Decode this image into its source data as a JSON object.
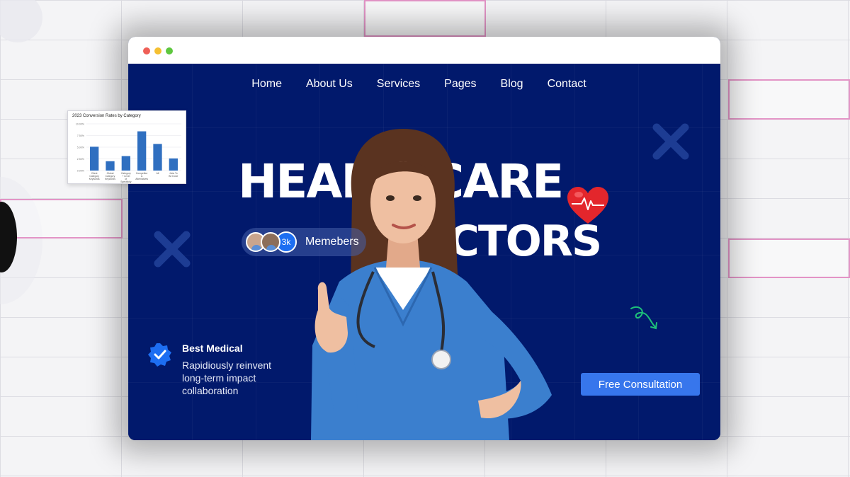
{
  "window": {
    "controls": [
      "close",
      "minimize",
      "maximize"
    ]
  },
  "nav": {
    "items": [
      {
        "label": "Home"
      },
      {
        "label": "About Us"
      },
      {
        "label": "Services"
      },
      {
        "label": "Pages"
      },
      {
        "label": "Blog"
      },
      {
        "label": "Contact"
      }
    ]
  },
  "hero": {
    "headline_line1": "HEALTHCARE",
    "headline_line2": "DOCTORS",
    "members": {
      "count": "3k",
      "label": "Memebers"
    },
    "feature": {
      "title": "Best Medical",
      "description": "Rapidiously reinvent long-term impact collaboration",
      "icon": "verified-badge-icon"
    },
    "cta_label": "Free Consultation"
  },
  "colors": {
    "hero_background": "#01196c",
    "cta": "#3776ec",
    "badge": "#1d6ef2",
    "heart": "#e3262c",
    "squiggle": "#1ec27a"
  },
  "chart_data": {
    "type": "bar",
    "title": "2023 Conversion Rates by Category",
    "categories": [
      "Client Category Keywords",
      "Global Category Keywords",
      "Category + Level of Specificity",
      "Competitor & Alternatives",
      "All",
      "Jobs To Be Done"
    ],
    "values": [
      5.1,
      2.0,
      3.1,
      8.4,
      5.7,
      2.6
    ],
    "ylim": [
      0,
      10
    ],
    "y_ticks": [
      "10.00%",
      "7.50%",
      "5.00%",
      "2.50%",
      "0.00%"
    ],
    "xlabel": "",
    "ylabel": ""
  }
}
